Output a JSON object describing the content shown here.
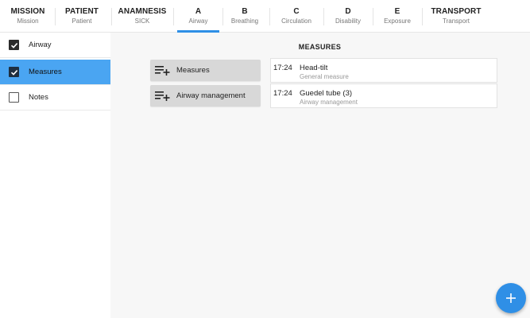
{
  "tabs": [
    {
      "label": "MISSION",
      "sub": "Mission"
    },
    {
      "label": "PATIENT",
      "sub": "Patient"
    },
    {
      "label": "ANAMNESIS",
      "sub": "SICK"
    },
    {
      "label": "A",
      "sub": "Airway",
      "active": true
    },
    {
      "label": "B",
      "sub": "Breathing"
    },
    {
      "label": "C",
      "sub": "Circulation"
    },
    {
      "label": "D",
      "sub": "Disability"
    },
    {
      "label": "E",
      "sub": "Exposure"
    },
    {
      "label": "TRANSPORT",
      "sub": "Transport"
    }
  ],
  "sidebar": {
    "items": [
      {
        "label": "Airway",
        "checked": true,
        "active": false
      },
      {
        "label": "Measures",
        "checked": true,
        "active": true
      },
      {
        "label": "Notes",
        "checked": false,
        "active": false
      }
    ]
  },
  "main": {
    "section_title": "MEASURES",
    "add_buttons": [
      {
        "label": "Measures",
        "icon": "playlist-add-icon"
      },
      {
        "label": "Airway management",
        "icon": "playlist-add-icon"
      }
    ],
    "entries": [
      {
        "time": "17:24",
        "name": "Head-tilt",
        "category": "General measure"
      },
      {
        "time": "17:24",
        "name": "Guedel tube (3)",
        "category": "Airway management"
      }
    ]
  },
  "fab": {
    "icon": "plus-icon"
  },
  "colors": {
    "accent": "#2f8fe6",
    "active_item": "#4aa5f2",
    "button_bg": "#d8d8d8"
  }
}
